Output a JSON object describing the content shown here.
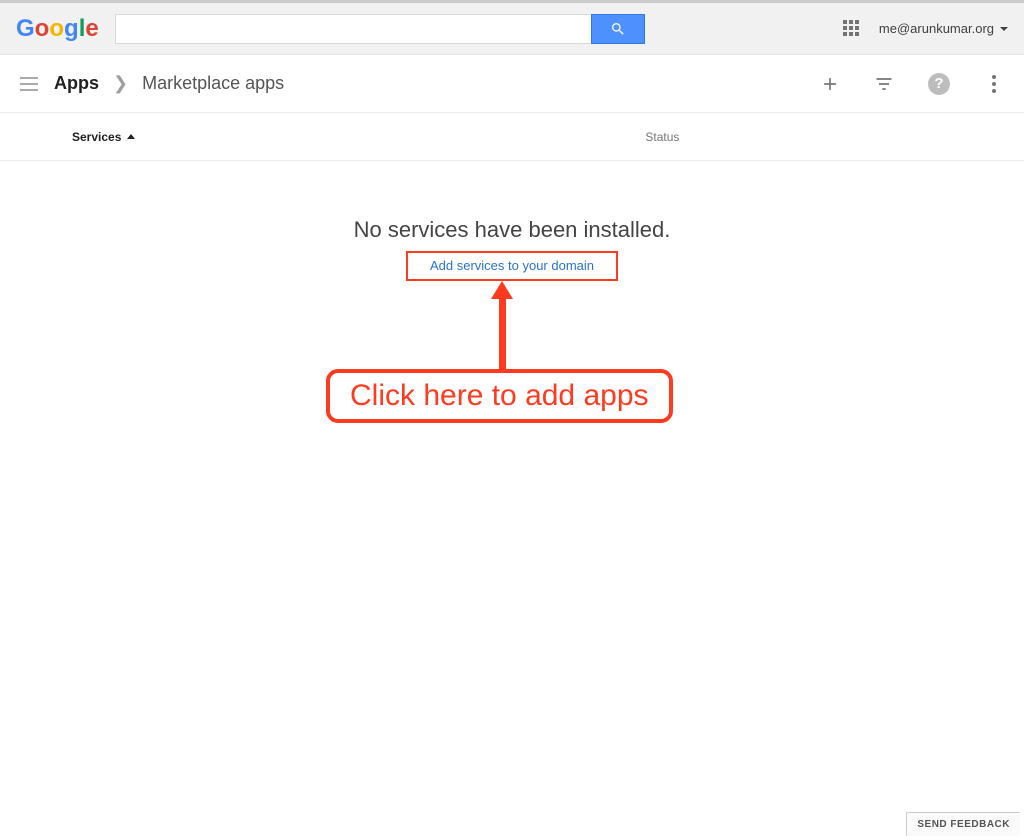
{
  "header": {
    "user_email": "me@arunkumar.org",
    "search_placeholder": ""
  },
  "breadcrumb": {
    "root": "Apps",
    "current": "Marketplace apps"
  },
  "table": {
    "col_services": "Services",
    "col_status": "Status"
  },
  "empty": {
    "title": "No services have been installed.",
    "add_link": "Add services to your domain"
  },
  "annotation": {
    "callout": "Click here to add apps"
  },
  "footer": {
    "feedback": "SEND FEEDBACK"
  },
  "help_glyph": "?"
}
